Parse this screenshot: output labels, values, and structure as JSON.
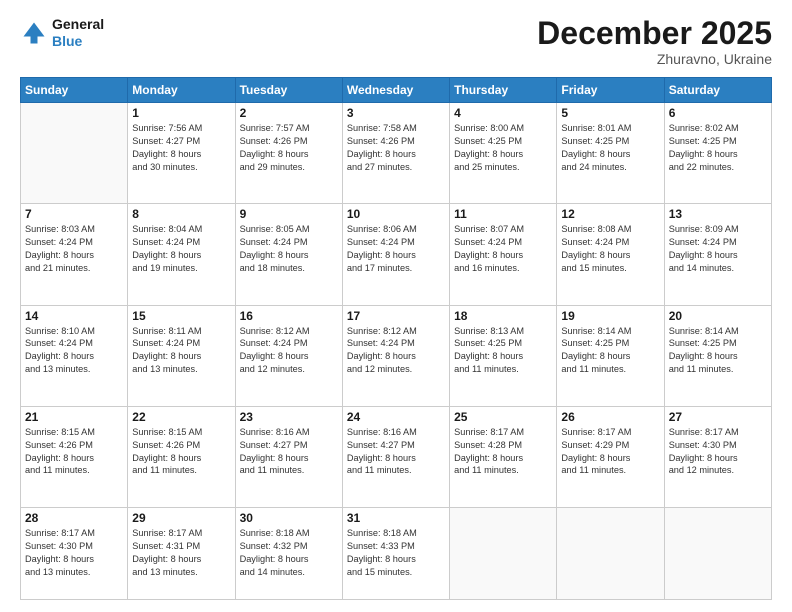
{
  "logo": {
    "line1": "General",
    "line2": "Blue"
  },
  "header": {
    "month": "December 2025",
    "location": "Zhuravno, Ukraine"
  },
  "weekdays": [
    "Sunday",
    "Monday",
    "Tuesday",
    "Wednesday",
    "Thursday",
    "Friday",
    "Saturday"
  ],
  "weeks": [
    [
      {
        "day": "",
        "info": ""
      },
      {
        "day": "1",
        "info": "Sunrise: 7:56 AM\nSunset: 4:27 PM\nDaylight: 8 hours\nand 30 minutes."
      },
      {
        "day": "2",
        "info": "Sunrise: 7:57 AM\nSunset: 4:26 PM\nDaylight: 8 hours\nand 29 minutes."
      },
      {
        "day": "3",
        "info": "Sunrise: 7:58 AM\nSunset: 4:26 PM\nDaylight: 8 hours\nand 27 minutes."
      },
      {
        "day": "4",
        "info": "Sunrise: 8:00 AM\nSunset: 4:25 PM\nDaylight: 8 hours\nand 25 minutes."
      },
      {
        "day": "5",
        "info": "Sunrise: 8:01 AM\nSunset: 4:25 PM\nDaylight: 8 hours\nand 24 minutes."
      },
      {
        "day": "6",
        "info": "Sunrise: 8:02 AM\nSunset: 4:25 PM\nDaylight: 8 hours\nand 22 minutes."
      }
    ],
    [
      {
        "day": "7",
        "info": "Sunrise: 8:03 AM\nSunset: 4:24 PM\nDaylight: 8 hours\nand 21 minutes."
      },
      {
        "day": "8",
        "info": "Sunrise: 8:04 AM\nSunset: 4:24 PM\nDaylight: 8 hours\nand 19 minutes."
      },
      {
        "day": "9",
        "info": "Sunrise: 8:05 AM\nSunset: 4:24 PM\nDaylight: 8 hours\nand 18 minutes."
      },
      {
        "day": "10",
        "info": "Sunrise: 8:06 AM\nSunset: 4:24 PM\nDaylight: 8 hours\nand 17 minutes."
      },
      {
        "day": "11",
        "info": "Sunrise: 8:07 AM\nSunset: 4:24 PM\nDaylight: 8 hours\nand 16 minutes."
      },
      {
        "day": "12",
        "info": "Sunrise: 8:08 AM\nSunset: 4:24 PM\nDaylight: 8 hours\nand 15 minutes."
      },
      {
        "day": "13",
        "info": "Sunrise: 8:09 AM\nSunset: 4:24 PM\nDaylight: 8 hours\nand 14 minutes."
      }
    ],
    [
      {
        "day": "14",
        "info": "Sunrise: 8:10 AM\nSunset: 4:24 PM\nDaylight: 8 hours\nand 13 minutes."
      },
      {
        "day": "15",
        "info": "Sunrise: 8:11 AM\nSunset: 4:24 PM\nDaylight: 8 hours\nand 13 minutes."
      },
      {
        "day": "16",
        "info": "Sunrise: 8:12 AM\nSunset: 4:24 PM\nDaylight: 8 hours\nand 12 minutes."
      },
      {
        "day": "17",
        "info": "Sunrise: 8:12 AM\nSunset: 4:24 PM\nDaylight: 8 hours\nand 12 minutes."
      },
      {
        "day": "18",
        "info": "Sunrise: 8:13 AM\nSunset: 4:25 PM\nDaylight: 8 hours\nand 11 minutes."
      },
      {
        "day": "19",
        "info": "Sunrise: 8:14 AM\nSunset: 4:25 PM\nDaylight: 8 hours\nand 11 minutes."
      },
      {
        "day": "20",
        "info": "Sunrise: 8:14 AM\nSunset: 4:25 PM\nDaylight: 8 hours\nand 11 minutes."
      }
    ],
    [
      {
        "day": "21",
        "info": "Sunrise: 8:15 AM\nSunset: 4:26 PM\nDaylight: 8 hours\nand 11 minutes."
      },
      {
        "day": "22",
        "info": "Sunrise: 8:15 AM\nSunset: 4:26 PM\nDaylight: 8 hours\nand 11 minutes."
      },
      {
        "day": "23",
        "info": "Sunrise: 8:16 AM\nSunset: 4:27 PM\nDaylight: 8 hours\nand 11 minutes."
      },
      {
        "day": "24",
        "info": "Sunrise: 8:16 AM\nSunset: 4:27 PM\nDaylight: 8 hours\nand 11 minutes."
      },
      {
        "day": "25",
        "info": "Sunrise: 8:17 AM\nSunset: 4:28 PM\nDaylight: 8 hours\nand 11 minutes."
      },
      {
        "day": "26",
        "info": "Sunrise: 8:17 AM\nSunset: 4:29 PM\nDaylight: 8 hours\nand 11 minutes."
      },
      {
        "day": "27",
        "info": "Sunrise: 8:17 AM\nSunset: 4:30 PM\nDaylight: 8 hours\nand 12 minutes."
      }
    ],
    [
      {
        "day": "28",
        "info": "Sunrise: 8:17 AM\nSunset: 4:30 PM\nDaylight: 8 hours\nand 13 minutes."
      },
      {
        "day": "29",
        "info": "Sunrise: 8:17 AM\nSunset: 4:31 PM\nDaylight: 8 hours\nand 13 minutes."
      },
      {
        "day": "30",
        "info": "Sunrise: 8:18 AM\nSunset: 4:32 PM\nDaylight: 8 hours\nand 14 minutes."
      },
      {
        "day": "31",
        "info": "Sunrise: 8:18 AM\nSunset: 4:33 PM\nDaylight: 8 hours\nand 15 minutes."
      },
      {
        "day": "",
        "info": ""
      },
      {
        "day": "",
        "info": ""
      },
      {
        "day": "",
        "info": ""
      }
    ]
  ]
}
